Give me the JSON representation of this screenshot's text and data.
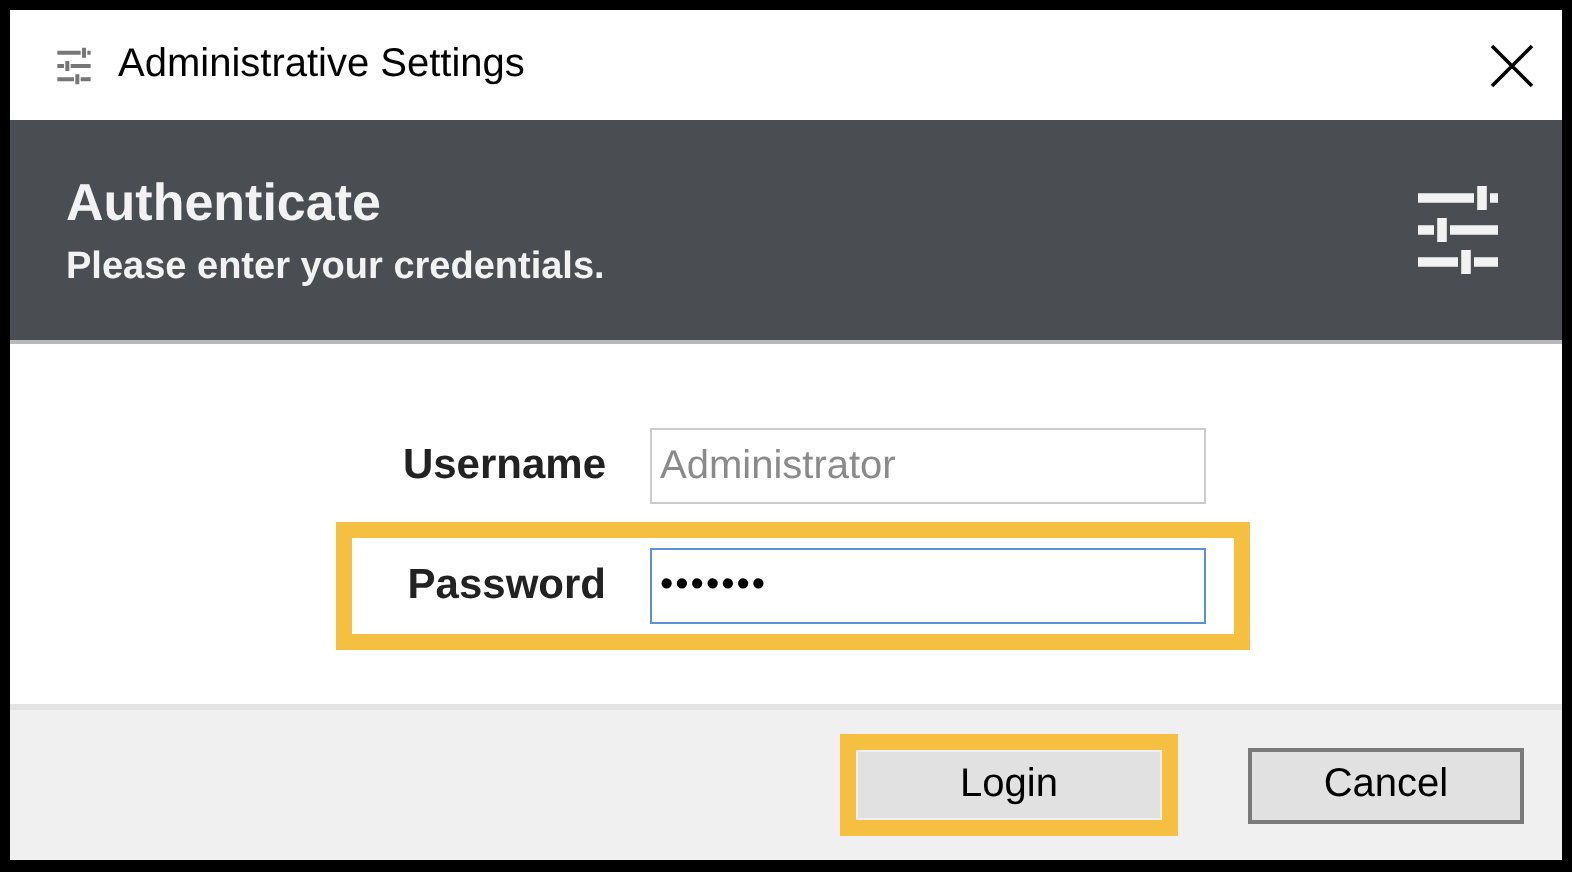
{
  "window": {
    "title": "Administrative Settings"
  },
  "header": {
    "title": "Authenticate",
    "subtitle": "Please enter your credentials."
  },
  "fields": [
    {
      "label": "Username",
      "value": "Administrator",
      "disabled": true,
      "focused": false,
      "highlighted": false
    },
    {
      "label": "Password",
      "value": "•••••••",
      "disabled": false,
      "focused": true,
      "highlighted": true
    }
  ],
  "buttons": [
    {
      "label": "Login",
      "highlighted": true
    },
    {
      "label": "Cancel",
      "highlighted": false
    }
  ]
}
